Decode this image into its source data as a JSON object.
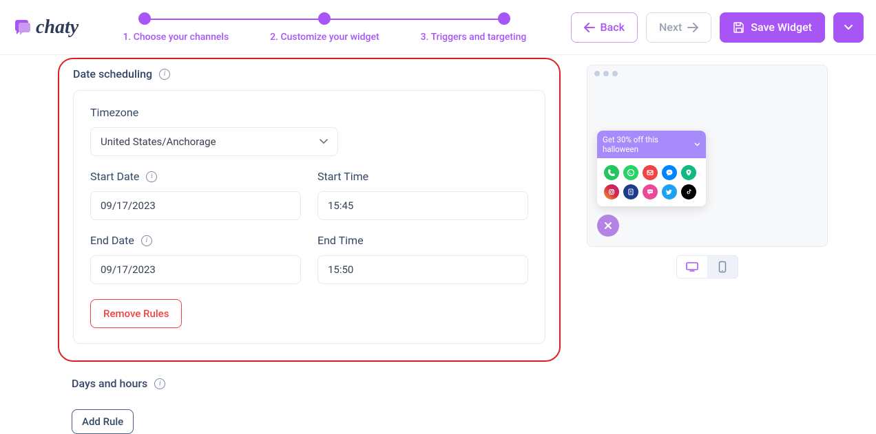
{
  "logo": {
    "text": "chaty"
  },
  "steps": {
    "s1": "1. Choose your channels",
    "s2": "2. Customize your widget",
    "s3": "3. Triggers and targeting"
  },
  "buttons": {
    "back": "Back",
    "next": "Next",
    "save": "Save Widget"
  },
  "scheduling": {
    "title": "Date scheduling",
    "timezone_label": "Timezone",
    "timezone_value": "United States/Anchorage",
    "start_date_label": "Start Date",
    "start_date_value": "09/17/2023",
    "start_time_label": "Start Time",
    "start_time_value": "15:45",
    "end_date_label": "End Date",
    "end_date_value": "09/17/2023",
    "end_time_label": "End Time",
    "end_time_value": "15:50",
    "remove": "Remove Rules"
  },
  "days": {
    "title": "Days and hours",
    "add": "Add Rule"
  },
  "preview": {
    "promo": "Get 30% off this halloween"
  },
  "colors": {
    "accent": "#a855f7",
    "danger": "#ef4444"
  }
}
